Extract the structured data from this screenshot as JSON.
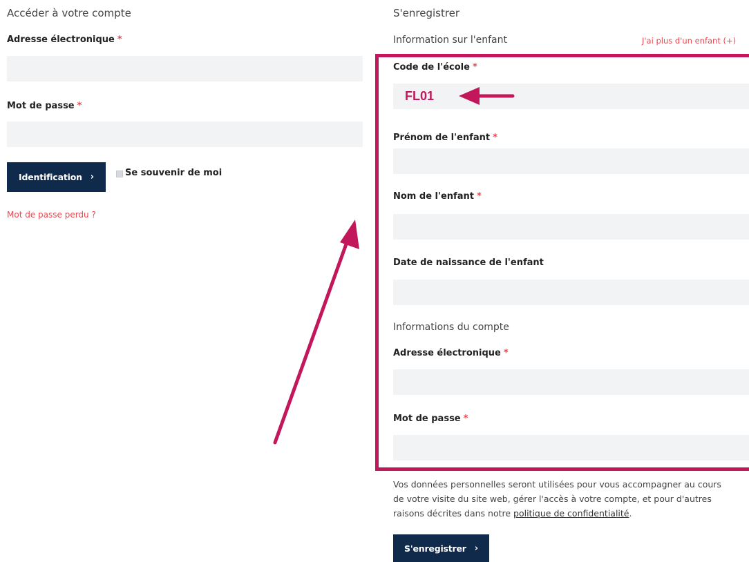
{
  "login": {
    "title": "Accéder à votre compte",
    "email_label": "Adresse électronique",
    "password_label": "Mot de passe",
    "required_mark": "*",
    "submit_label": "Identification",
    "remember_label": "Se souvenir de moi",
    "lost_password": "Mot de passe perdu ?"
  },
  "register": {
    "title": "S'enregistrer",
    "child_section": "Information sur l'enfant",
    "more_children": "J'ai plus d'un enfant (+)",
    "school_code_label": "Code de l'école",
    "school_code_value": "FL01",
    "first_name_label": "Prénom de l'enfant",
    "last_name_label": "Nom de l'enfant",
    "birthdate_label": "Date de naissance de l'enfant",
    "account_section": "Informations du compte",
    "email_label": "Adresse électronique",
    "password_label": "Mot de passe",
    "privacy_text": "Vos données personnelles seront utilisées pour vous accompagner au cours de votre visite du site web, gérer l'accès à votre compte, et pour d'autres raisons décrites dans notre ",
    "privacy_link": "politique de confidentialité",
    "privacy_end": ".",
    "submit_label": "S'enregistrer"
  },
  "colors": {
    "button_bg": "#102a4c",
    "required": "#e8474f",
    "annotation": "#c2185b",
    "field_bg": "#f1f3f5"
  },
  "icons": {
    "chevron": "chevron-right-icon"
  }
}
